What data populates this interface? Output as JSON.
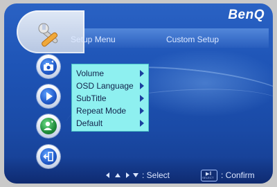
{
  "brand": "BenQ",
  "header": {
    "title": "Setup Menu",
    "subtitle": "Custom Setup"
  },
  "sidebar": {
    "items": [
      {
        "name": "photo-setup",
        "icon": "camera-icon",
        "active": false
      },
      {
        "name": "playback",
        "icon": "play-icon",
        "active": false
      },
      {
        "name": "custom-setup",
        "icon": "person-settings-icon",
        "active": true
      },
      {
        "name": "exit",
        "icon": "exit-icon",
        "active": false
      }
    ]
  },
  "menu": {
    "items": [
      {
        "label": "Volume"
      },
      {
        "label": "OSD Language"
      },
      {
        "label": "SubTitle"
      },
      {
        "label": "Repeat Mode"
      },
      {
        "label": "Default"
      }
    ]
  },
  "footer": {
    "select_label": ": Select",
    "key_label": "SELECT",
    "confirm_label": ": Confirm"
  },
  "colors": {
    "background": "#1e54b6",
    "menu_bg": "#8ef0f0",
    "text": "#dce8ff"
  }
}
